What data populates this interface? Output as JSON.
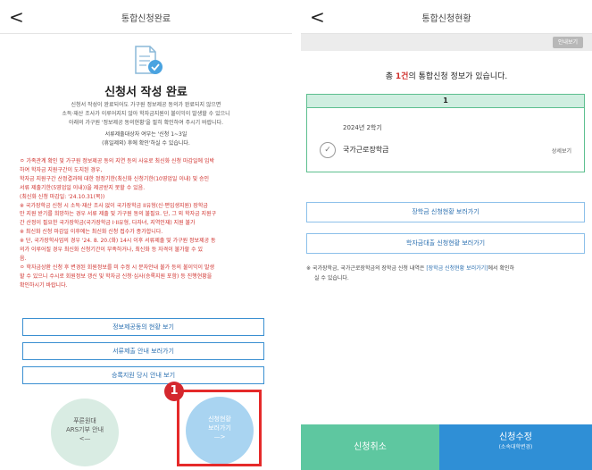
{
  "left": {
    "header": {
      "back": "<",
      "title": "통합신청완료"
    },
    "title": "신청서 작성 완료",
    "desc": [
      "신청서 작성이 완료되어도 가구원 정보제공 동의가 완료되지 않으면",
      "소득·재산 조사가 이루어지지 않아 학자금지원이 불이익이 발생할 수 있으니",
      "아래의 가구원 '정보제공 동의현황'을 필히 확인하여 주시기 바랍니다."
    ],
    "sub_lines": [
      "서류제출대상자 여부는 '신청 1~3일",
      "(휴일제외) 후에 확인'하실 수 있습니다."
    ],
    "notes": [
      "ㅇ 가족관계 확인 및 가구원 정보제공 동의 지연 등의 사유로 최신화 신청 마감일에 임박",
      "하여 학자금 지원구간이 도지된 경우,",
      "학자금 지원구간 산정결과에 대한 정정기한(최신화 신청기한(10영업일 이내) 및 승인",
      "서류 제출기한(5영업일 이내))을 제공받지 못할 수 있음.",
      "(최신화 신청 마감일: '24.10.31(목))",
      "※ 국가장학금 신청 시 소득·재산 조사 없이 국가장학금 II유형(신·편입생지원) 장학금",
      "만 지원 받기를 희망하는 경우 서류 제출 및 가구원 동의 불필요. 단, 그 외 학자금 지원구",
      "간 산정이 필요한 국가장학금(국가장학금 I·II유형, 다자녀, 지역인재) 지원 불가",
      "※ 최신화 신청 마감일 이후에는 최신화 신청 접수가 종가합니다.",
      "※ 단, 국가장학사업의 경우 '24. 8. 20.(화) 14시 이후 서류제출 및 가구원 정보제공 동",
      "의가 이루어질 경우 최신화 신청기간이 부족하거나, 최신화 등 자격이 불가할 수 있",
      "음.",
      "ㅇ 학자금상환 신청 후 변경된 회원정보를 미 수정 시 문자안내 불가 등의 불이익이 발생",
      "할 수 있으니 수시로 회원정보 갱신 및 학자금 신청·심사(승록지원 포함) 등 진행현황을",
      "확인하시기 바랍니다."
    ],
    "buttons": [
      "정보제공동의 현황 보기",
      "서류제출 안내 보러가기",
      "승록지원 당시 안내 보기"
    ],
    "circle_gray": [
      "푸른원대",
      "ARS기부 안내",
      "<—"
    ],
    "circle_blue": [
      "신청현황",
      "보러가기",
      "—>"
    ],
    "badge": "1"
  },
  "right": {
    "header": {
      "back": "<",
      "title": "통합신청현황"
    },
    "guide_button": "안내보기",
    "count_prefix": "총 ",
    "count_num": "1건",
    "count_suffix": "의 통합신청 정보가 있습니다.",
    "card": {
      "index": "1",
      "year": "2024년 2학기",
      "check": "✓",
      "name": "국가근로장학금",
      "detail": "상세보기"
    },
    "buttons": [
      "장학금 신청현황 보러가기",
      "학자금대출 신청현황 보러가기"
    ],
    "note_before": "※ 국가장학금, 국가근로장학금의 장학금 신청 내역은 ",
    "note_link": "[장학금 신청현황 보러가기]",
    "note_after": "에서 확인하",
    "note_line2": "실 수 있습니다.",
    "footer": {
      "cancel": "신청취소",
      "edit": "신청수정",
      "edit_sub": "(소속대학변경)"
    }
  }
}
